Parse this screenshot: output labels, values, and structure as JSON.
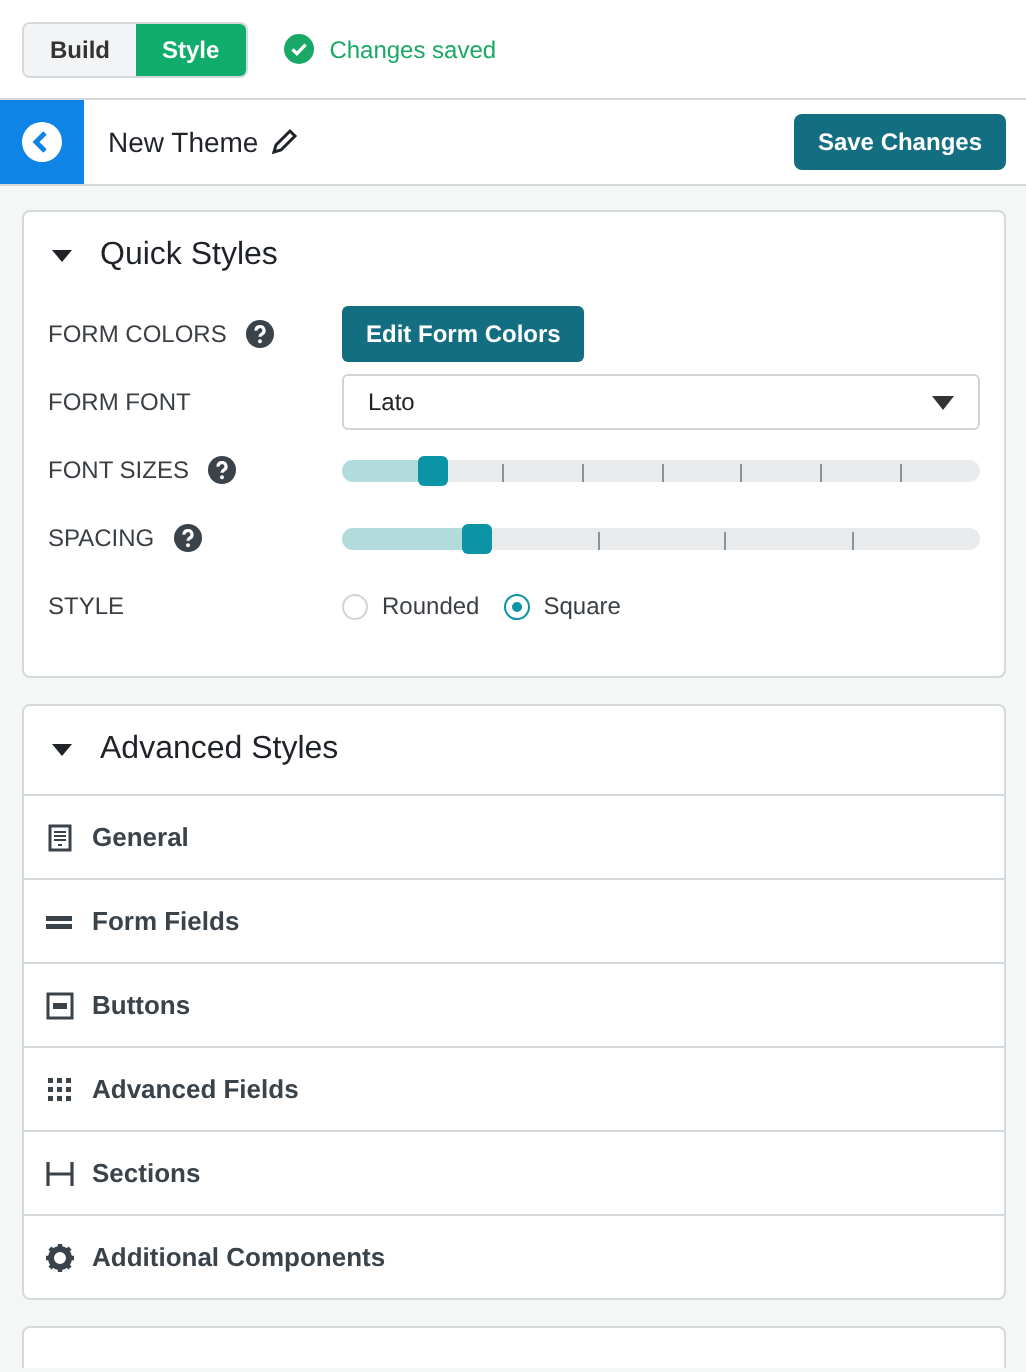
{
  "mode_tabs": [
    {
      "label": "Build",
      "selected": false
    },
    {
      "label": "Style",
      "selected": true
    }
  ],
  "save_status": "Changes saved",
  "header": {
    "title": "New Theme",
    "save_button": "Save Changes"
  },
  "quick_styles": {
    "title": "Quick Styles",
    "expanded": true,
    "rows": [
      {
        "kind": "button",
        "label": "FORM COLORS",
        "help": true,
        "button": "Edit Form Colors"
      },
      {
        "kind": "select",
        "label": "FORM FONT",
        "help": false,
        "value": "Lato"
      },
      {
        "kind": "slider",
        "label": "FONT SIZES",
        "help": true,
        "level": 0.14
      },
      {
        "kind": "slider",
        "label": "SPACING",
        "help": true,
        "level": 0.21
      },
      {
        "kind": "radio",
        "label": "STYLE",
        "help": false,
        "options": [
          {
            "label": "Rounded",
            "selected": false
          },
          {
            "label": "Square",
            "selected": true
          }
        ]
      }
    ]
  },
  "advanced_styles": {
    "title": "Advanced Styles",
    "expanded": true,
    "items": [
      {
        "kind": "general",
        "label": "General"
      },
      {
        "kind": "fields",
        "label": "Form Fields"
      },
      {
        "kind": "buttons",
        "label": "Buttons"
      },
      {
        "kind": "advanced",
        "label": "Advanced Fields"
      },
      {
        "kind": "sections",
        "label": "Sections"
      },
      {
        "kind": "components",
        "label": "Additional Components"
      }
    ]
  }
}
